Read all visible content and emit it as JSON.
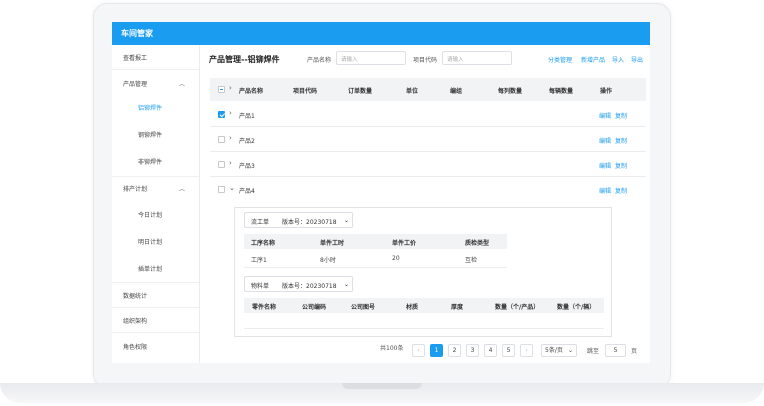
{
  "app": {
    "brand": "车间管家"
  },
  "sidebar": {
    "items": [
      {
        "label": "查看报工"
      },
      {
        "label": "产品管理"
      },
      {
        "label": "铝铆焊件"
      },
      {
        "label": "钢铆焊件"
      },
      {
        "label": "非铆焊件"
      },
      {
        "label": "排产计划"
      },
      {
        "label": "今日计划"
      },
      {
        "label": "明日计划"
      },
      {
        "label": "插单计划"
      },
      {
        "label": "数据统计"
      },
      {
        "label": "组织架构"
      },
      {
        "label": "角色权限"
      }
    ]
  },
  "header": {
    "title": "产品管理--铝铆焊件",
    "product_name_label": "产品名称",
    "product_name_placeholder": "请输入",
    "project_code_label": "项目代码",
    "project_code_placeholder": "请输入",
    "actions": [
      "分类管理",
      "新增产品",
      "导入",
      "导出"
    ]
  },
  "table": {
    "columns": [
      "产品名称",
      "项目代码",
      "订单数量",
      "单位",
      "编组",
      "每列数量",
      "每辆数量",
      "操作"
    ],
    "rows": [
      {
        "name": "产品1",
        "checked": true,
        "edit": "编辑",
        "copy": "复制"
      },
      {
        "name": "产品2",
        "checked": false,
        "edit": "编辑",
        "copy": "复制"
      },
      {
        "name": "产品3",
        "checked": false,
        "edit": "编辑",
        "copy": "复制"
      },
      {
        "name": "产品4",
        "checked": false,
        "edit": "编辑",
        "copy": "复制"
      }
    ]
  },
  "detail": {
    "process": {
      "type": "流工单",
      "version": "版本号：20230718",
      "columns": [
        "工序名称",
        "单件工时",
        "单件工价",
        "质检类型"
      ],
      "row": [
        "工序1",
        "8小时",
        "20",
        "互检"
      ]
    },
    "material": {
      "type": "物料单",
      "version": "版本号：20230718",
      "columns": [
        "零件名称",
        "公司编码",
        "公司图号",
        "材质",
        "厚度",
        "数量（个/产品）",
        "数量（个/辆）"
      ]
    }
  },
  "pagination": {
    "total": "共100条",
    "pages": [
      "1",
      "2",
      "3",
      "4",
      "5"
    ],
    "current": "1",
    "page_size": "5条/页",
    "goto_label": "跳至",
    "goto_value": "5",
    "page_unit": "页"
  },
  "colors": {
    "accent": "#1a9cf0"
  }
}
